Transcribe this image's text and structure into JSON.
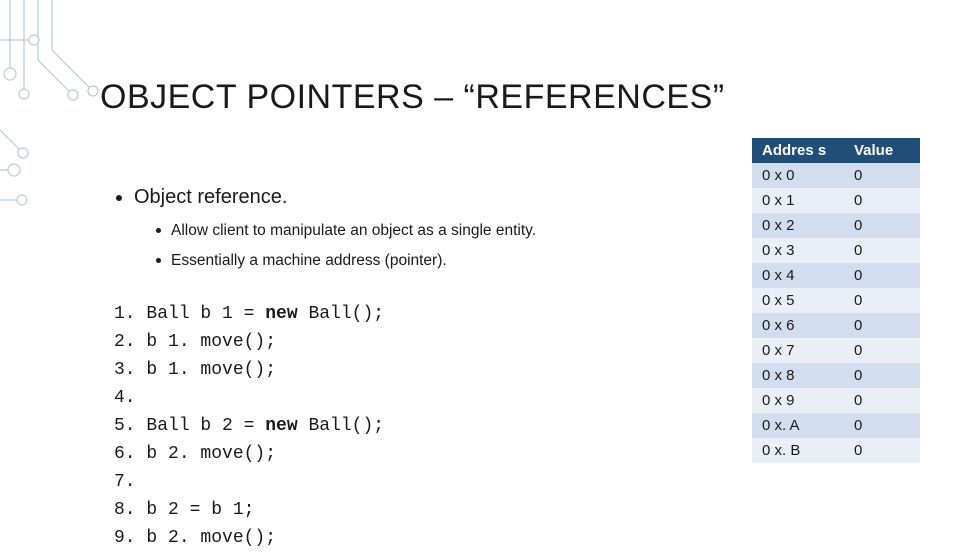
{
  "title": "OBJECT POINTERS – “REFERENCES”",
  "bullets": {
    "main": "Object reference.",
    "sub1": "Allow client to manipulate an object as a single entity.",
    "sub2": "Essentially a machine address (pointer)."
  },
  "code": [
    {
      "n": "1.",
      "text": " Ball b 1 = ",
      "kw": "new",
      "rest": " Ball();"
    },
    {
      "n": "2.",
      "text": " b 1. move();"
    },
    {
      "n": "3.",
      "text": " b 1. move();"
    },
    {
      "n": "4.",
      "text": ""
    },
    {
      "n": "5.",
      "text": " Ball b 2 = ",
      "kw": "new",
      "rest": " Ball();"
    },
    {
      "n": "6.",
      "text": " b 2. move();"
    },
    {
      "n": "7.",
      "text": ""
    },
    {
      "n": "8.",
      "text": " b 2 = b 1;"
    },
    {
      "n": "9.",
      "text": " b 2. move();"
    }
  ],
  "table": {
    "headers": {
      "a": "Addres s",
      "v": "Value"
    },
    "rows": [
      {
        "a": "0 x 0",
        "v": "0"
      },
      {
        "a": "0 x 1",
        "v": "0"
      },
      {
        "a": "0 x 2",
        "v": "0"
      },
      {
        "a": "0 x 3",
        "v": "0"
      },
      {
        "a": "0 x 4",
        "v": "0"
      },
      {
        "a": "0 x 5",
        "v": "0"
      },
      {
        "a": "0 x 6",
        "v": "0"
      },
      {
        "a": "0 x 7",
        "v": "0"
      },
      {
        "a": "0 x 8",
        "v": "0"
      },
      {
        "a": "0 x 9",
        "v": "0"
      },
      {
        "a": "0 x. A",
        "v": "0"
      },
      {
        "a": "0 x. B",
        "v": "0"
      }
    ]
  }
}
